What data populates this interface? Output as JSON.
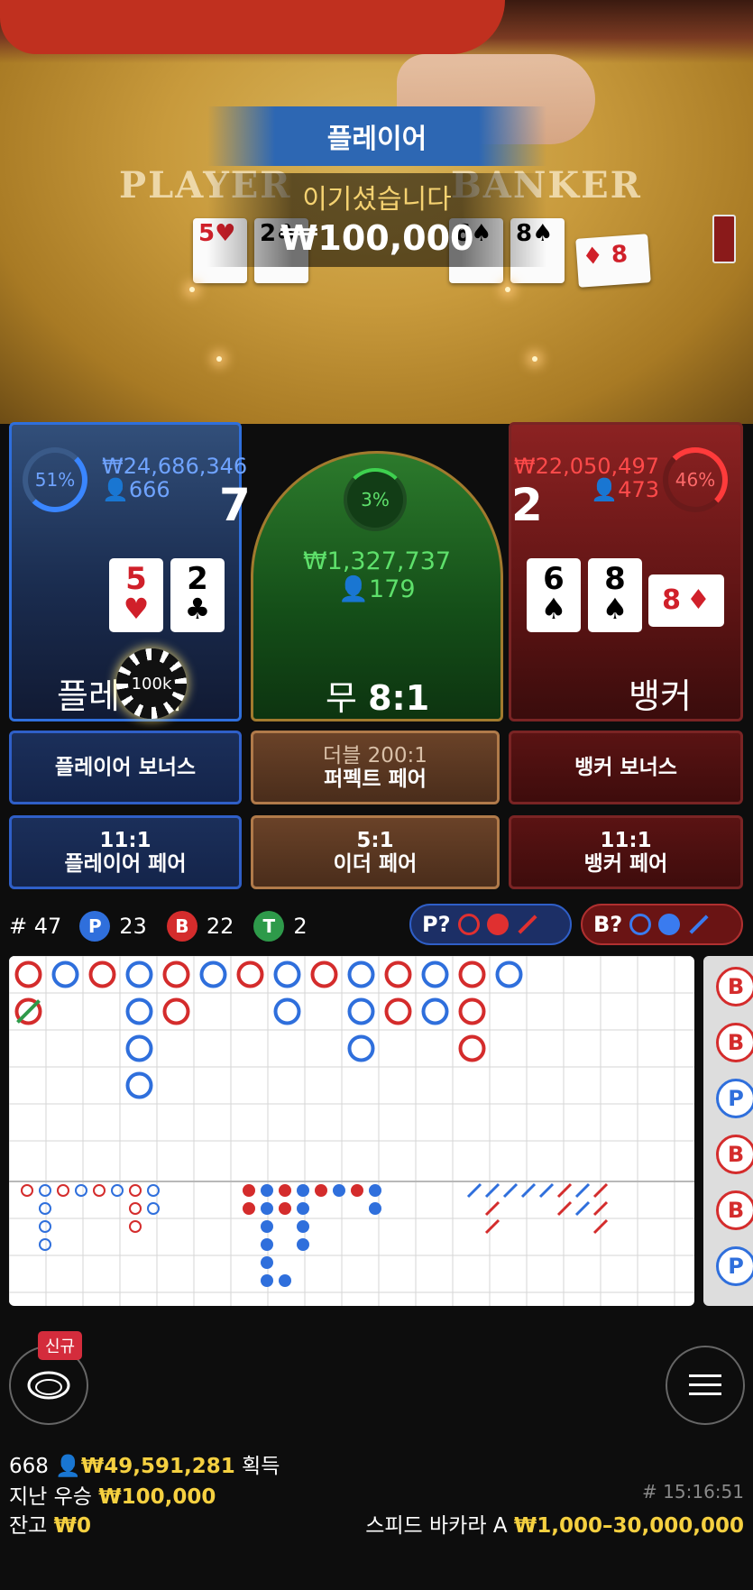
{
  "video": {
    "banner": "플레이어",
    "win_text": "이기셨습니다",
    "win_amount": "₩100,000",
    "table_player": "PLAYER",
    "table_banker": "BANKER"
  },
  "player": {
    "percent": "51%",
    "amount": "₩24,686,346",
    "users": "666",
    "score": "7",
    "cards": [
      {
        "rank": "5",
        "suit": "♥",
        "color": "#d0202a"
      },
      {
        "rank": "2",
        "suit": "♣",
        "color": "#000"
      }
    ],
    "label": "플레이어",
    "chip": "100k"
  },
  "tie": {
    "percent": "3%",
    "amount": "₩1,327,737",
    "users": "179",
    "label": "무",
    "payout": "8:1"
  },
  "banker": {
    "percent": "46%",
    "amount": "₩22,050,497",
    "users": "473",
    "score": "2",
    "cards": [
      {
        "rank": "6",
        "suit": "♠",
        "color": "#000"
      },
      {
        "rank": "8",
        "suit": "♠",
        "color": "#000"
      },
      {
        "rank": "8",
        "suit": "♦",
        "color": "#d0202a"
      }
    ],
    "label": "뱅커"
  },
  "side_bets": {
    "player_bonus": "플레이어 보너스",
    "perfect_pair_top": "더블 200:1",
    "perfect_pair_bottom": "퍼펙트 페어",
    "banker_bonus": "뱅커 보너스",
    "player_pair_top": "11:1",
    "player_pair_bottom": "플레이어 페어",
    "either_pair_top": "5:1",
    "either_pair_bottom": "이더 페어",
    "banker_pair_top": "11:1",
    "banker_pair_bottom": "뱅커 페어"
  },
  "stats": {
    "round": "# 47",
    "p_label": "P",
    "p_count": "23",
    "b_label": "B",
    "b_count": "22",
    "t_label": "T",
    "t_count": "2",
    "p_predict": "P?",
    "b_predict": "B?"
  },
  "colors": {
    "player": "#2f6fdc",
    "banker": "#d42c2c",
    "tie": "#2e9a4a",
    "gold": "#f5d040"
  },
  "bigroad": [
    [
      "B",
      "P",
      "B",
      "P",
      "B",
      "P",
      "B",
      "P",
      "B",
      "P",
      "B",
      "P",
      "B",
      "P"
    ],
    [
      "BT",
      "",
      "",
      "P",
      "B",
      "",
      "",
      "P",
      "",
      "P",
      "B",
      "P",
      "B",
      ""
    ],
    [
      "",
      "",
      "",
      "P",
      "",
      "",
      "",
      "",
      "",
      "P",
      "",
      "",
      "B",
      ""
    ],
    [
      "",
      "",
      "",
      "P",
      "",
      "",
      "",
      "",
      "",
      "",
      "",
      "",
      "",
      ""
    ]
  ],
  "bigroad_cols": [
    [
      "B",
      "BT"
    ],
    [
      "P"
    ],
    [
      "B"
    ],
    [
      "P",
      "P",
      "P",
      "P"
    ],
    [
      "B",
      "B"
    ],
    [
      "P"
    ],
    [
      "B"
    ],
    [
      "P",
      "P"
    ],
    [
      "B"
    ],
    [
      "P",
      "P",
      "P"
    ],
    [
      "B",
      "B"
    ],
    [
      "P",
      "P"
    ],
    [
      "B",
      "B",
      "B"
    ],
    [
      "P"
    ]
  ],
  "side_road": [
    "B",
    "B",
    "P",
    "B",
    "B",
    "P"
  ],
  "bottom": {
    "new_badge": "신규",
    "users": "668",
    "total_win": "₩49,591,281",
    "total_win_label": "획득",
    "last_win_label": "지난 우승",
    "last_win": "₩100,000",
    "balance_label": "잔고",
    "balance": "₩0",
    "round_id": "# 15:16:51",
    "table_name": "스피드 바카라 A",
    "limits": "₩1,000–30,000,000"
  }
}
